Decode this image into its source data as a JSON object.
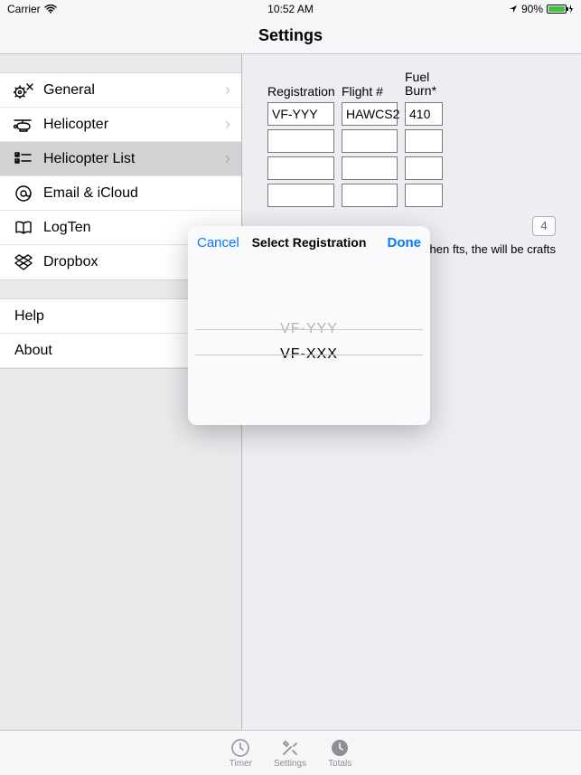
{
  "statusbar": {
    "carrier": "Carrier",
    "time": "10:52 AM",
    "battery_pct": "90%"
  },
  "navbar": {
    "title": "Settings"
  },
  "sidebar": {
    "items": [
      {
        "label": "General"
      },
      {
        "label": "Helicopter"
      },
      {
        "label": "Helicopter List"
      },
      {
        "label": "Email & iCloud"
      },
      {
        "label": "LogTen"
      },
      {
        "label": "Dropbox"
      }
    ],
    "extras": [
      {
        "label": "Help"
      },
      {
        "label": "About"
      }
    ]
  },
  "detail": {
    "headers": {
      "registration": "Registration",
      "flight": "Flight #",
      "fuel": "Fuel Burn*"
    },
    "rows": [
      {
        "reg": "VF-YYY",
        "flt": "HAWCS2",
        "fuel": "410"
      },
      {
        "reg": "",
        "flt": "",
        "fuel": ""
      },
      {
        "reg": "",
        "flt": "",
        "fuel": ""
      },
      {
        "reg": "",
        "flt": "",
        "fuel": ""
      }
    ],
    "smallbtn": "4",
    "note": "When fts, the will be crafts"
  },
  "popover": {
    "cancel": "Cancel",
    "title": "Select Registration",
    "done": "Done",
    "options": [
      "VF-YYY",
      "VF-XXX"
    ]
  },
  "tabs": {
    "timer": "Timer",
    "settings": "Settings",
    "totals": "Totals"
  }
}
